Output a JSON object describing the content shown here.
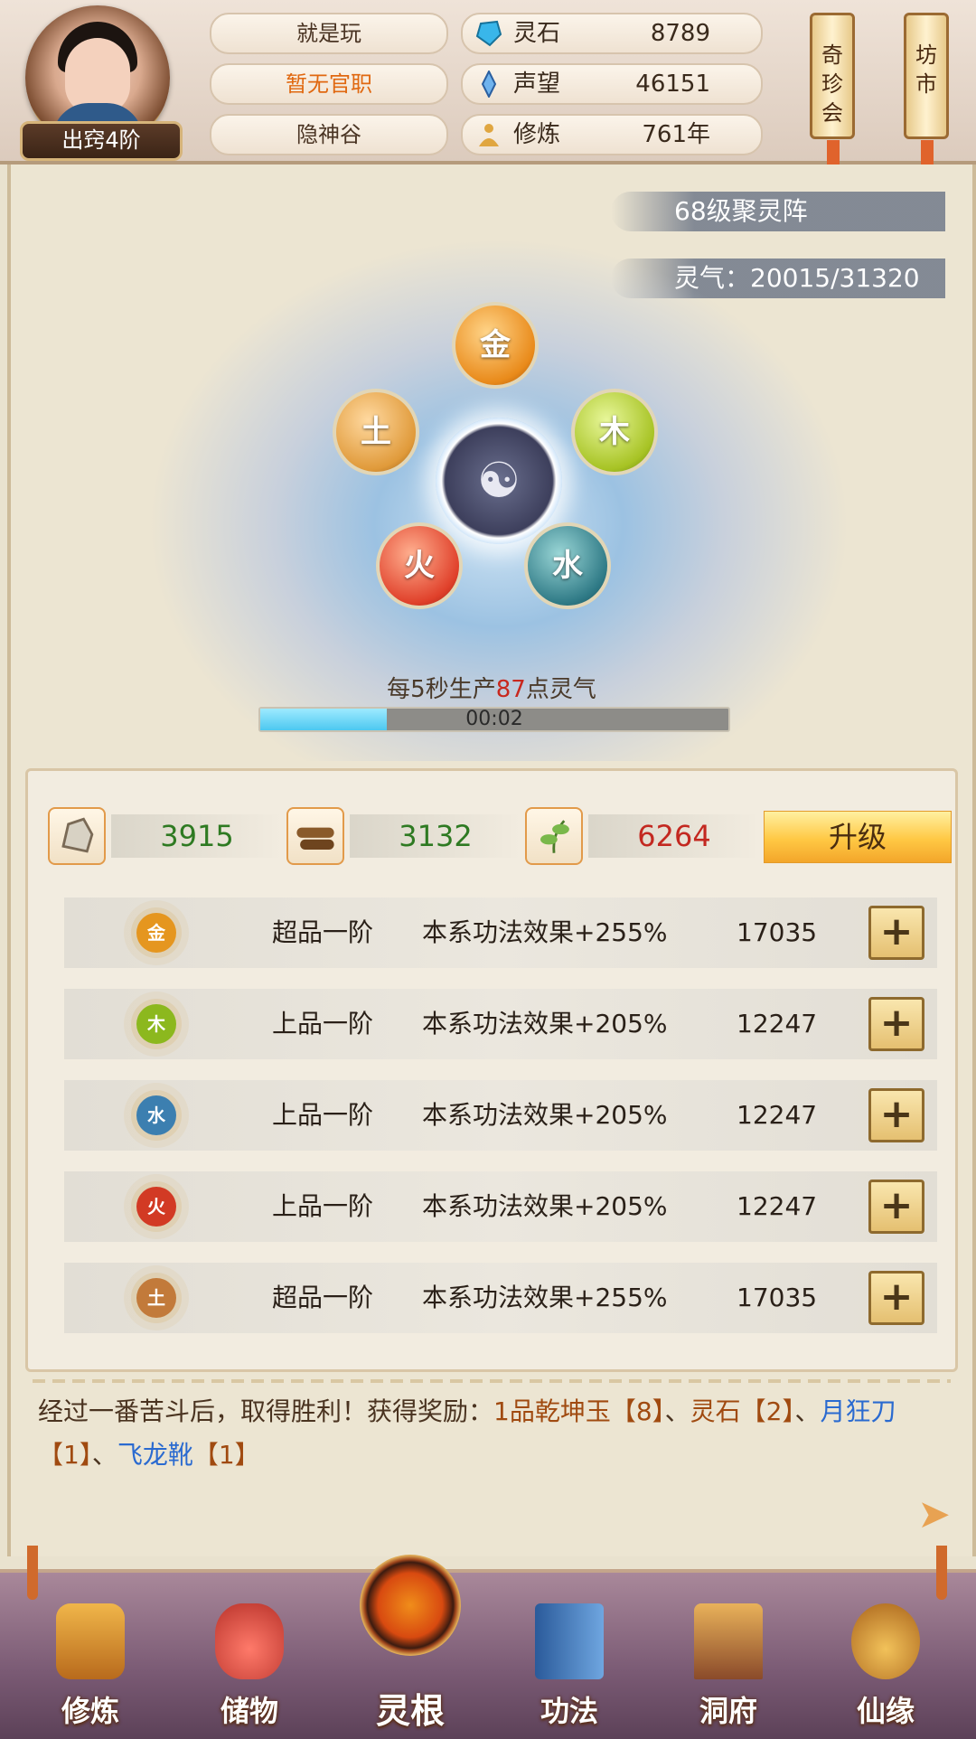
{
  "player": {
    "name": "就是玩",
    "title": "暂无官职",
    "sect": "隐神谷",
    "rank": "出窍4阶"
  },
  "resources": [
    {
      "label": "灵石",
      "value": "8789",
      "icon": "spirit-stone-icon"
    },
    {
      "label": "声望",
      "value": "46151",
      "icon": "reputation-icon"
    },
    {
      "label": "修炼",
      "value": "761年",
      "icon": "cultivation-icon"
    }
  ],
  "side_buttons": {
    "qizhenhui": "奇珍会",
    "fangshi": "坊市"
  },
  "formation": {
    "name": "68级聚灵阵",
    "qi": "灵气：20015/31320",
    "produce_prefix": "每5秒生产",
    "produce_amount": "87",
    "produce_suffix": "点灵气",
    "timer": "00:02",
    "progress": 0.27,
    "orbs": {
      "jin": "金",
      "mu": "木",
      "shui": "水",
      "huo": "火",
      "tu": "土"
    },
    "center": "☯"
  },
  "materials": [
    {
      "value": "3915",
      "icon": "ore-icon",
      "color": "green"
    },
    {
      "value": "3132",
      "icon": "wood-icon",
      "color": "green"
    },
    {
      "value": "6264",
      "icon": "herb-icon",
      "color": "red"
    }
  ],
  "upgrade_label": "升级",
  "roots": [
    {
      "element": "金",
      "grade": "超品一阶",
      "effect": "本系功法效果+255%",
      "value": "17035",
      "color": "#e5961f"
    },
    {
      "element": "木",
      "grade": "上品一阶",
      "effect": "本系功法效果+205%",
      "value": "12247",
      "color": "#8cb81e"
    },
    {
      "element": "水",
      "grade": "上品一阶",
      "effect": "本系功法效果+205%",
      "value": "12247",
      "color": "#3c7fb0"
    },
    {
      "element": "火",
      "grade": "上品一阶",
      "effect": "本系功法效果+205%",
      "value": "12247",
      "color": "#d23a24"
    },
    {
      "element": "土",
      "grade": "超品一阶",
      "effect": "本系功法效果+255%",
      "value": "17035",
      "color": "#c27a3a"
    }
  ],
  "plus_label": "+",
  "log": {
    "part1": "经过一番苦斗后，取得胜利！获得奖励：",
    "item1": "1品乾坤玉【8】",
    "sep1": "、",
    "item2": "灵石【2】",
    "sep2": "、",
    "item3": "月狂刀",
    "count3": "【1】",
    "sep3": "、",
    "item4": "飞龙靴",
    "count4": "【1】"
  },
  "nav": [
    {
      "label": "修炼",
      "icon": "cultivate-icon"
    },
    {
      "label": "储物",
      "icon": "storage-bag-icon"
    },
    {
      "label": "灵根",
      "icon": "spirit-root-icon",
      "active": true
    },
    {
      "label": "功法",
      "icon": "technique-book-icon"
    },
    {
      "label": "洞府",
      "icon": "cave-residence-icon"
    },
    {
      "label": "仙缘",
      "icon": "immortal-fate-icon"
    }
  ]
}
